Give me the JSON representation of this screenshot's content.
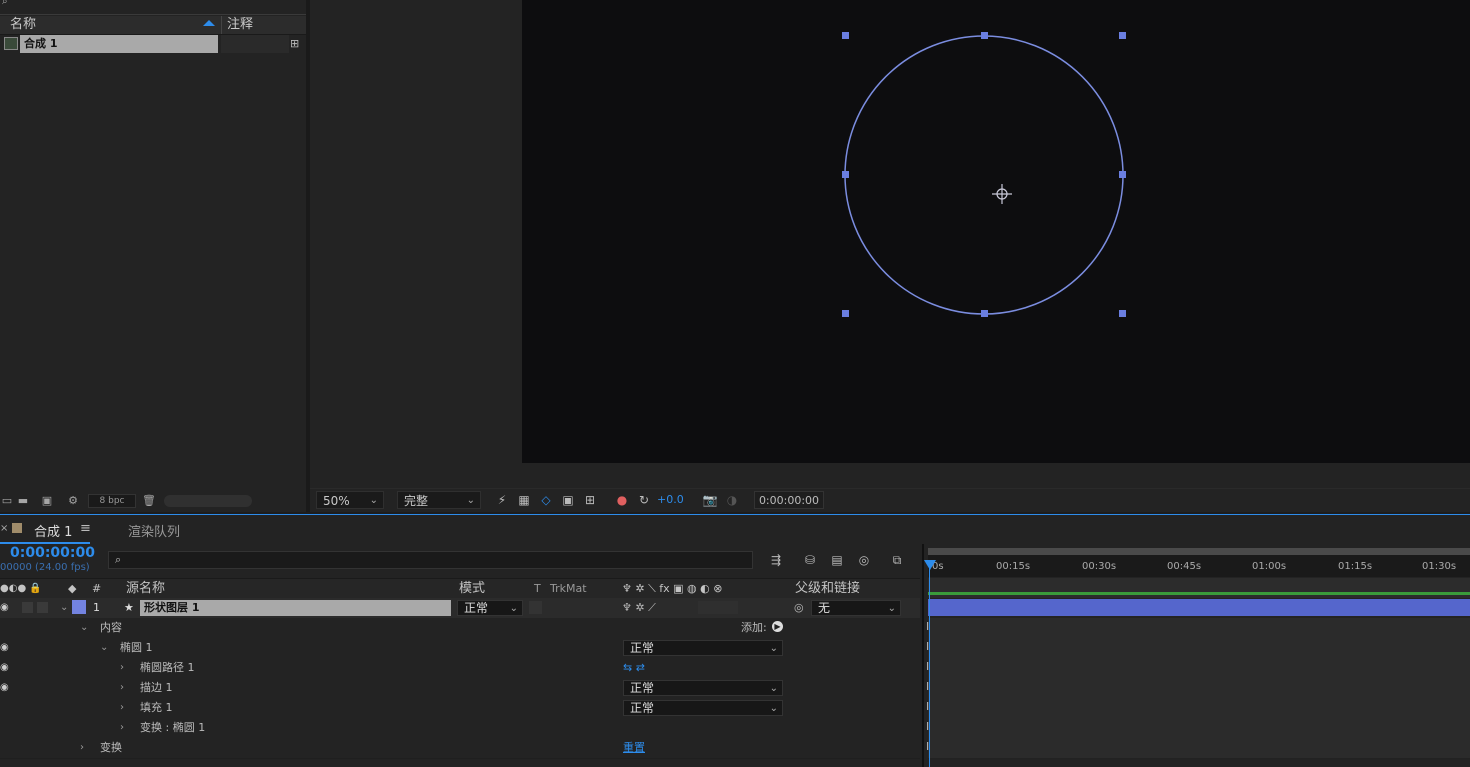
{
  "project": {
    "col_name": "名称",
    "col_comment": "注释",
    "item_name": "合成 1",
    "bpc": "8 bpc"
  },
  "viewer": {
    "zoom": "50%",
    "resolution": "完整",
    "exposure": "+0.0",
    "timecode": "0:00:00:00"
  },
  "timeline": {
    "comp_tab": "合成 1",
    "render_tab": "渲染队列",
    "current_time": "0:00:00:00",
    "fps_label": "00000 (24.00 fps)",
    "cols": {
      "num": "#",
      "source": "源名称",
      "mode": "模式",
      "t": "T",
      "trkmat": "TrkMat",
      "parent": "父级和链接"
    },
    "layer": {
      "num": "1",
      "name": "形状图层 1",
      "mode": "正常",
      "parent": "无"
    },
    "props": {
      "contents": "内容",
      "add": "添加:",
      "ellipse_group": "椭圆 1",
      "ellipse_group_mode": "正常",
      "ellipse_path": "椭圆路径 1",
      "stroke": "描边 1",
      "stroke_mode": "正常",
      "fill": "填充 1",
      "fill_mode": "正常",
      "transform_ellipse": "变换 : 椭圆 1",
      "transform": "变换",
      "reset": "重置"
    },
    "ruler_ticks": [
      "0s",
      "00:15s",
      "00:30s",
      "00:45s",
      "01:00s",
      "01:15s",
      "01:30s"
    ]
  },
  "colors": {
    "accent": "#2d8ceb",
    "shape_stroke": "#7b8de0",
    "layer_bar": "#5566cc",
    "label_color": "#7383e0"
  }
}
